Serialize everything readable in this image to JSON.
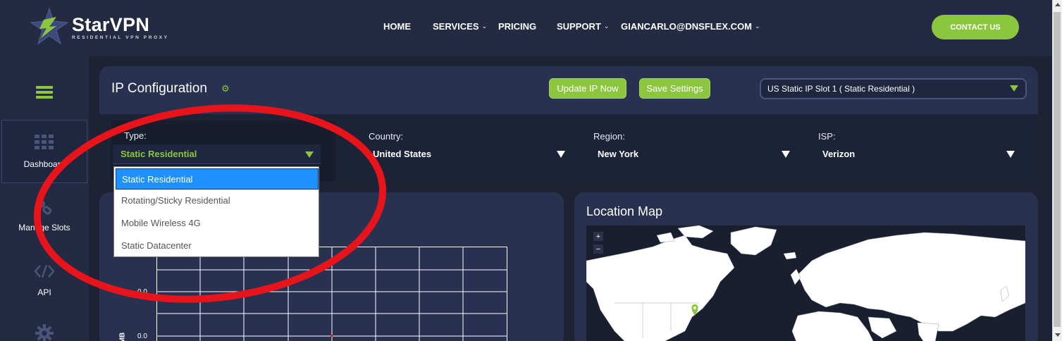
{
  "brand": {
    "name": "StarVPN",
    "tagline": "RESIDENTIAL VPN PROXY"
  },
  "nav": {
    "home": "HOME",
    "services": "SERVICES",
    "pricing": "PRICING",
    "support": "SUPPORT",
    "account": "GIANCARLO@DNSFLEX.COM",
    "contact": "CONTACT US"
  },
  "sidebar": {
    "items": [
      {
        "label": "Dashboard",
        "icon": "grid-icon"
      },
      {
        "label": "Manage Slots",
        "icon": "link-icon"
      },
      {
        "label": "API",
        "icon": "code-icon"
      },
      {
        "label": "",
        "icon": "gear-icon"
      }
    ]
  },
  "ip_config": {
    "title": "IP Configuration",
    "update_button": "Update IP Now",
    "save_button": "Save Settings",
    "slot_selected": "US Static IP Slot 1 ( Static Residential )"
  },
  "filters": {
    "type_label": "Type:",
    "type_value": "Static Residential",
    "country_label": "Country:",
    "country_value": "United States",
    "region_label": "Region:",
    "region_value": "New York",
    "isp_label": "ISP:",
    "isp_value": "Verizon"
  },
  "type_options": [
    "Static Residential",
    "Rotating/Sticky Residential",
    "Mobile Wireless 4G",
    "Static Datacenter"
  ],
  "chart": {
    "tick_1": "0.0",
    "tick_2": "0.0",
    "ylabel_fragment": "MB"
  },
  "map": {
    "title": "Location Map",
    "zoom_in": "+",
    "zoom_out": "−"
  },
  "colors": {
    "accent": "#8cc63f",
    "background": "#1d2235",
    "card": "#283250",
    "annotation": "#e8141b"
  }
}
